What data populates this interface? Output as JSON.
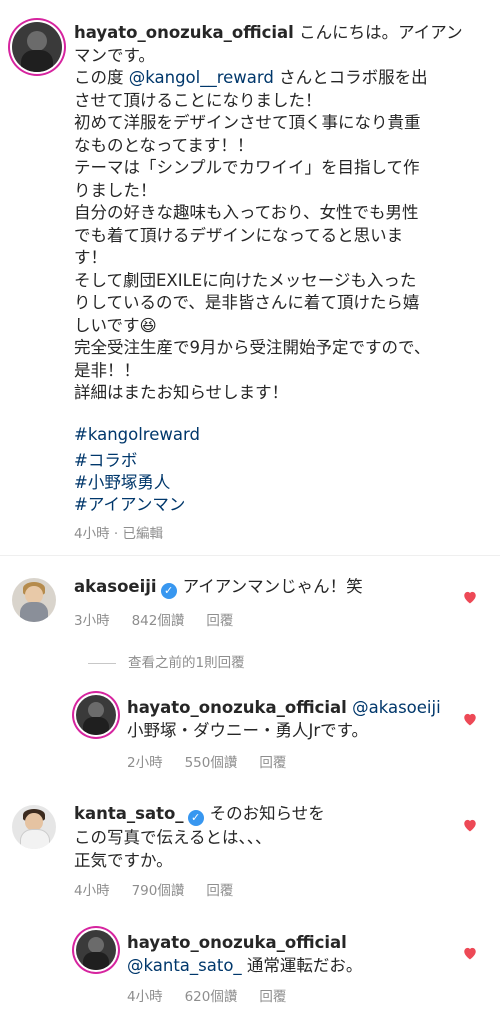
{
  "post": {
    "username": "hayato_onozuka_official",
    "caption_lines": [
      "こんにちは。アイアン",
      "マンです。",
      "この度 ",
      "@kangol__reward",
      " さんとコラボ服を出",
      "させて頂けることになりました！",
      "初めて洋服をデザインさせて頂く事になり貴重",
      "なものとなってます！！",
      "テーマは「シンプルでカワイイ」を目指して作",
      "りました！",
      "自分の好きな趣味も入っており、女性でも男性",
      "でも着て頂けるデザインになってると思いま",
      "す！",
      "そして劇団EXILEに向けたメッセージも入った",
      "りしているので、是非皆さんに着て頂けたら嬉",
      "しいです😆",
      "完全受注生産で9月から受注開始予定ですので、",
      "是非！！",
      "詳細はまたお知らせします！"
    ],
    "hashtags": [
      "#kangolreward",
      "#コラボ",
      "#小野塚勇人",
      "#アイアンマン"
    ],
    "meta": "4小時 · 已編輯"
  },
  "comments": [
    {
      "username": "akasoeiji",
      "verified": true,
      "text": "アイアンマンじゃん！笑",
      "time": "3小時",
      "likes": "842個讚",
      "reply": "回覆"
    },
    {
      "view_previous": "查看之前的1則回覆"
    },
    {
      "username": "hayato_onozuka_official",
      "mention": "@akasoeiji",
      "text": "小野塚・ダウニー・勇人Jrです。",
      "time": "2小時",
      "likes": "550個讚",
      "reply": "回覆"
    },
    {
      "username": "kanta_sato_",
      "verified": true,
      "text_lines": [
        "そのお知らせを",
        "この写真で伝えるとは、、、",
        "正気ですか。"
      ],
      "time": "4小時",
      "likes": "790個讚",
      "reply": "回覆"
    },
    {
      "username": "hayato_onozuka_official",
      "mention": "@kanta_sato_",
      "text": " 通常運転だお。",
      "time": "4小時",
      "likes": "620個讚",
      "reply": "回覆"
    }
  ],
  "colors": {
    "heart": "#ed4956",
    "link": "#00376b",
    "muted": "#8e8e8e"
  },
  "icons": [
    "heart-icon",
    "verified-badge-icon"
  ]
}
